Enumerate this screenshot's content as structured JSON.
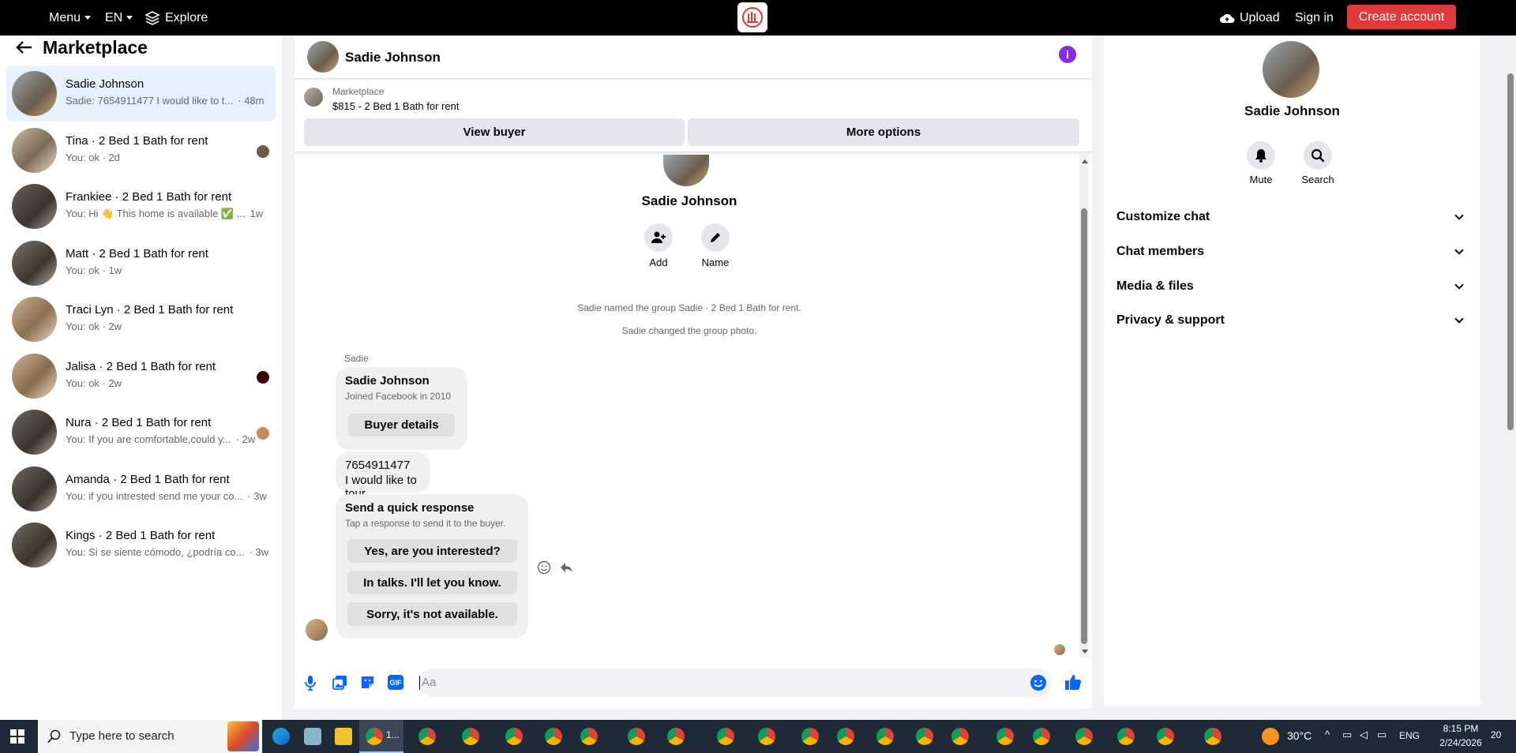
{
  "topbar": {
    "menu": "Menu",
    "language": "EN",
    "explore": "Explore",
    "upload": "Upload",
    "signin": "Sign in",
    "create_account": "Create account"
  },
  "left": {
    "title": "Marketplace",
    "conversations": [
      {
        "title": "Sadie Johnson",
        "preview": "Sadie: 7654911477 I would like to t...",
        "time": "· 48m",
        "active": true
      },
      {
        "title": "Tina · 2 Bed 1 Bath for rent",
        "preview": "You: ok · 2d",
        "time": ""
      },
      {
        "title": "Frankiee · 2 Bed 1 Bath for rent",
        "preview": "You: Hi 👋 This home is available ✅ ...",
        "time": "1w"
      },
      {
        "title": "Matt · 2 Bed 1 Bath for rent",
        "preview": "You: ok · 1w",
        "time": ""
      },
      {
        "title": "Traci Lyn · 2 Bed 1 Bath for rent",
        "preview": "You: ok · 2w",
        "time": ""
      },
      {
        "title": "Jalisa · 2 Bed 1 Bath for rent",
        "preview": "You: ok · 2w",
        "time": ""
      },
      {
        "title": "Nura · 2 Bed 1 Bath for rent",
        "preview": "You: If you are comfortable,could y...",
        "time": "· 2w"
      },
      {
        "title": "Amanda · 2 Bed 1 Bath for rent",
        "preview": "You: if you intrested send me your co...",
        "time": "· 3w"
      },
      {
        "title": "Kings · 2 Bed 1 Bath for rent",
        "preview": "You: Si se siente cómodo, ¿podría co...",
        "time": "· 3w"
      }
    ]
  },
  "chat": {
    "header_name": "Sadie Johnson",
    "listing_source": "Marketplace",
    "listing": "$815 - 2 Bed 1 Bath for rent",
    "view_buyer": "View buyer",
    "more_options": "More options",
    "profile_name": "Sadie Johnson",
    "add_label": "Add",
    "name_label": "Name",
    "event1": "Sadie named the group Sadie · 2 Bed 1 Bath for rent.",
    "event2": "Sadie changed the group photo.",
    "sender": "Sadie",
    "card_name": "Sadie Johnson",
    "card_sub": "Joined Facebook in 2010",
    "buyer_details": "Buyer details",
    "msg_line1": "7654911477",
    "msg_line2": "I would like to tour",
    "qr_title": "Send a quick response",
    "qr_sub": "Tap a response to send it to the buyer.",
    "qr_options": [
      "Yes, are you interested?",
      "In talks. I'll let you know.",
      "Sorry, it's not available."
    ],
    "composer_placeholder": "Aa"
  },
  "right": {
    "name": "Sadie Johnson",
    "mute": "Mute",
    "search": "Search",
    "sections": [
      "Customize chat",
      "Chat members",
      "Media & files",
      "Privacy & support"
    ]
  },
  "taskbar": {
    "search_placeholder": "Type here to search",
    "active_app_label": "1...",
    "weather": "30°C",
    "language": "ENG",
    "time": "8:15 PM",
    "date": "2/24/2026",
    "notifications": "20"
  },
  "colors": {
    "accent_blue": "#0866ff",
    "create_red": "#e0393e",
    "info_purple": "#8a2be2"
  }
}
